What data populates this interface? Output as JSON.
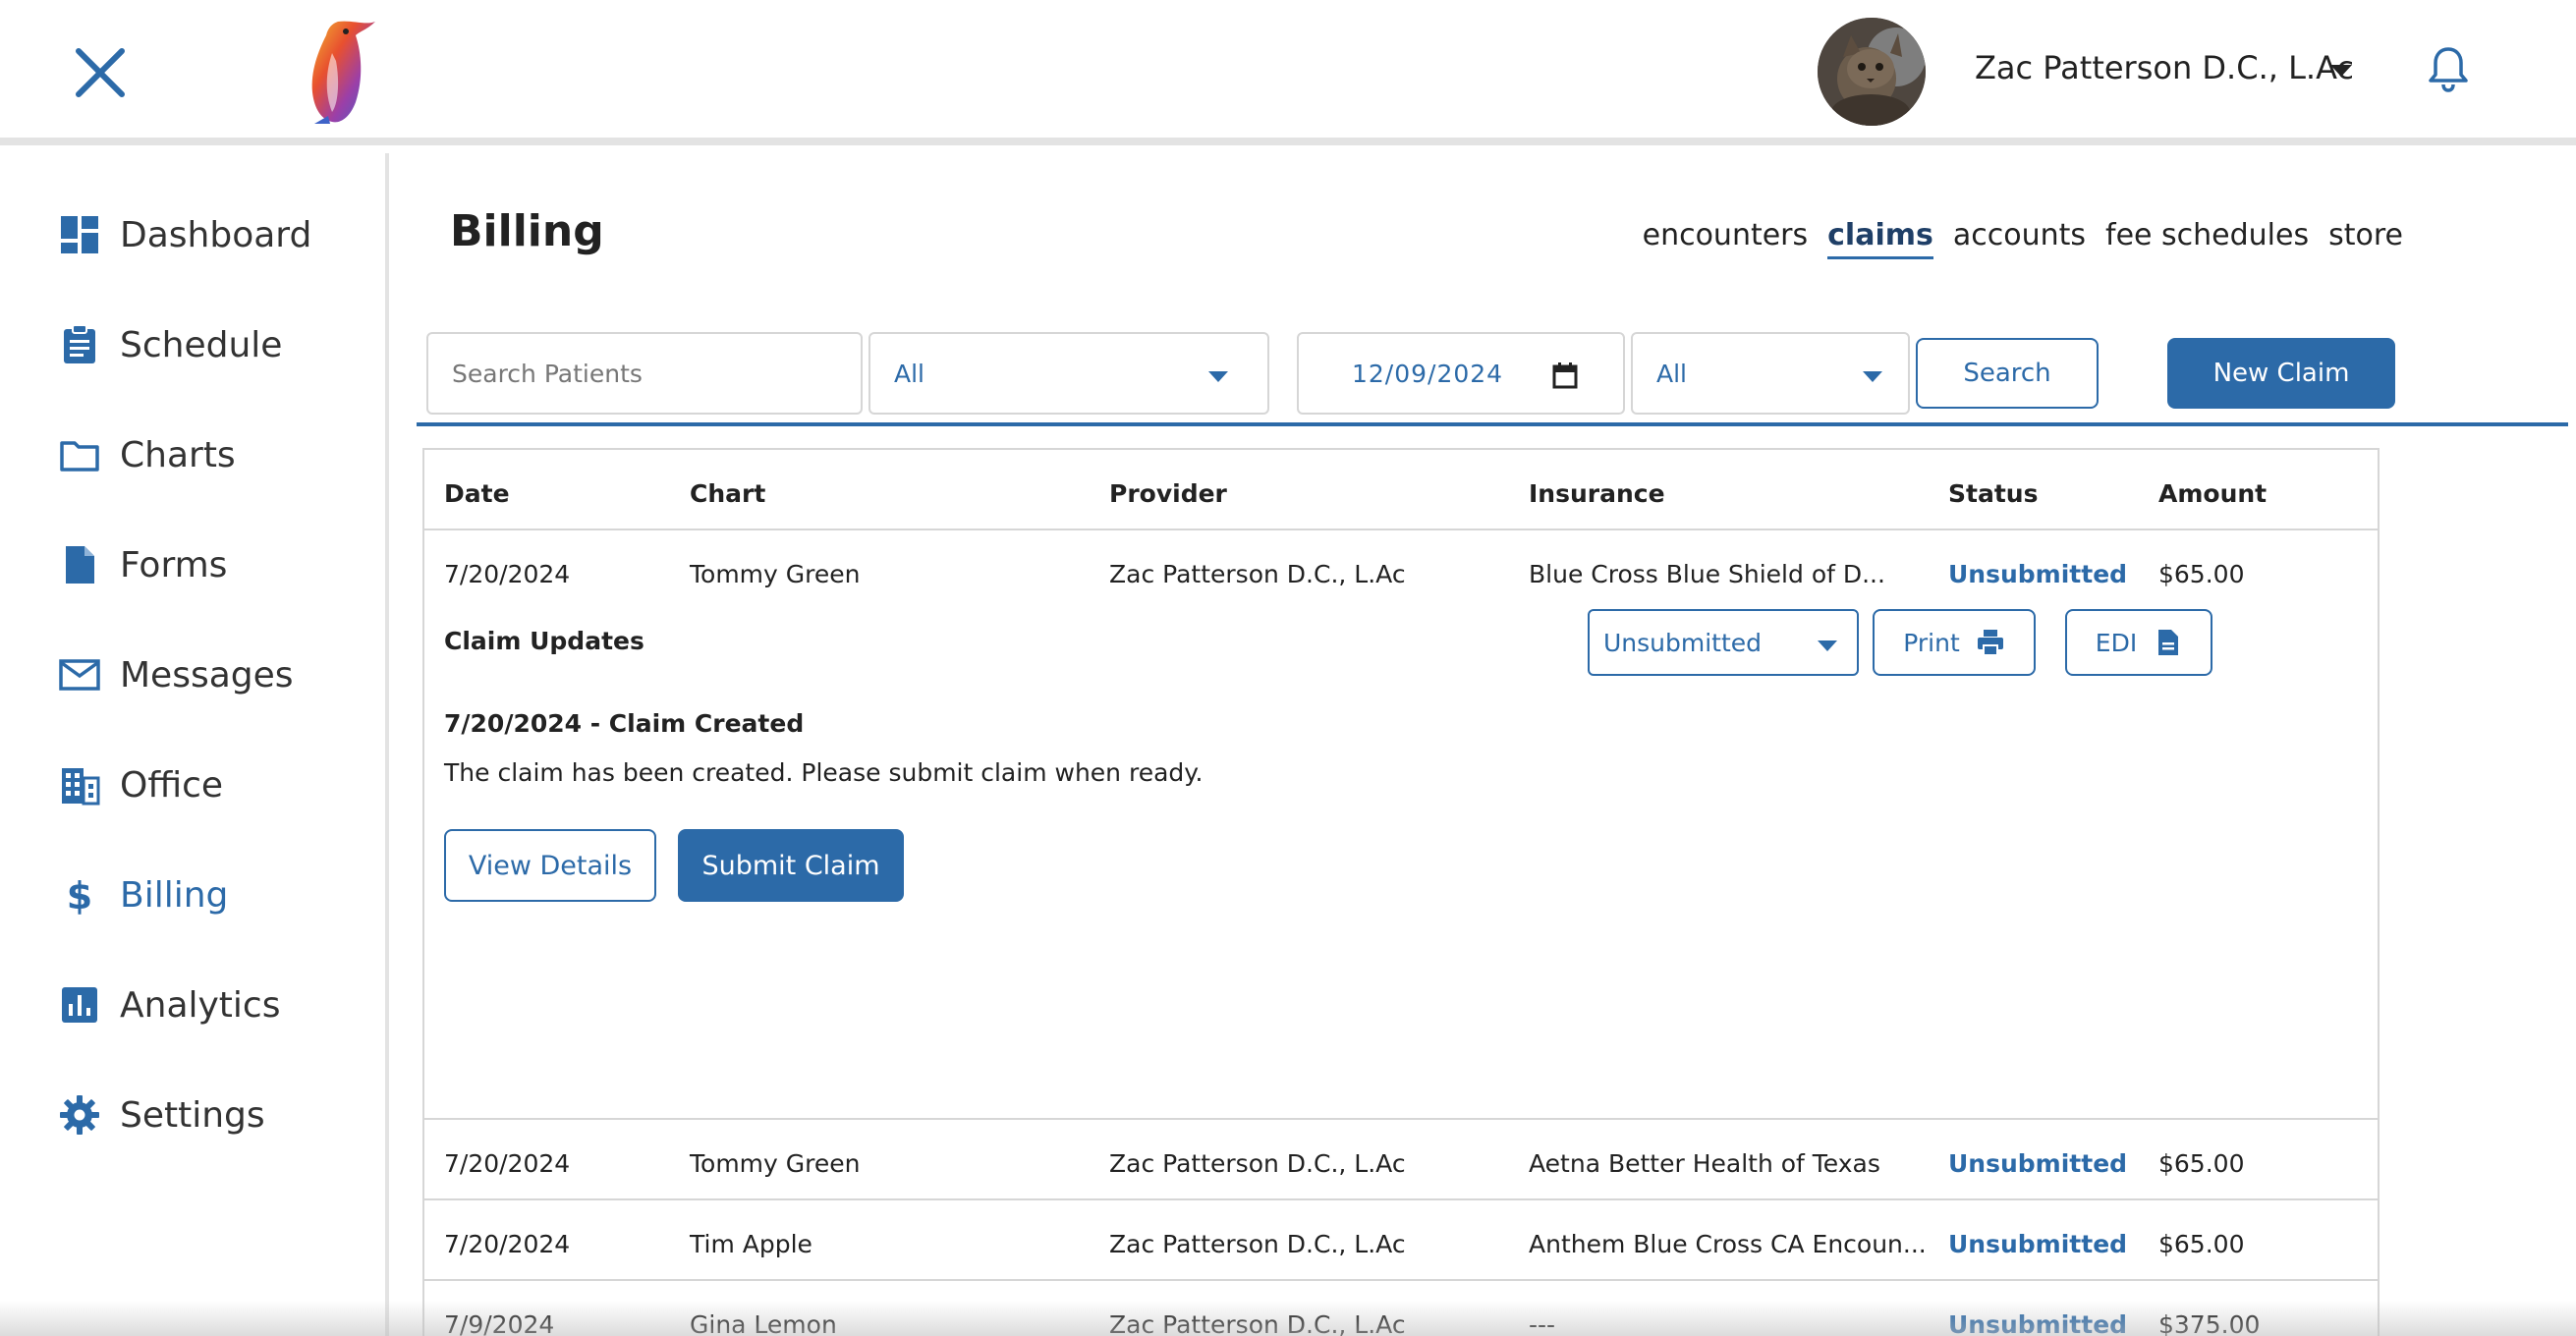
{
  "header": {
    "user_name": "Zac Patterson D.C., L.Ac"
  },
  "sidebar": {
    "items": [
      {
        "label": "Dashboard",
        "icon": "dashboard-icon"
      },
      {
        "label": "Schedule",
        "icon": "clipboard-icon"
      },
      {
        "label": "Charts",
        "icon": "folder-icon"
      },
      {
        "label": "Forms",
        "icon": "document-icon"
      },
      {
        "label": "Messages",
        "icon": "mail-icon"
      },
      {
        "label": "Office",
        "icon": "building-icon"
      },
      {
        "label": "Billing",
        "icon": "dollar-icon",
        "active": true
      },
      {
        "label": "Analytics",
        "icon": "bar-chart-icon"
      },
      {
        "label": "Settings",
        "icon": "gear-icon"
      }
    ]
  },
  "page": {
    "title": "Billing",
    "tabs": [
      {
        "label": "encounters"
      },
      {
        "label": "claims",
        "active": true
      },
      {
        "label": "accounts"
      },
      {
        "label": "fee schedules"
      },
      {
        "label": "store"
      }
    ]
  },
  "filters": {
    "search_placeholder": "Search Patients",
    "provider_select": "All",
    "date_value": "12/09/2024",
    "status_select": "All",
    "search_button": "Search",
    "new_claim_button": "New Claim"
  },
  "table": {
    "columns": [
      "Date",
      "Chart",
      "Provider",
      "Insurance",
      "Status",
      "Amount"
    ],
    "rows": [
      {
        "date": "7/20/2024",
        "chart": "Tommy Green",
        "provider": "Zac Patterson D.C., L.Ac",
        "insurance": "Blue Cross Blue Shield of D...",
        "status": "Unsubmitted",
        "amount": "$65.00"
      },
      {
        "date": "7/20/2024",
        "chart": "Tommy Green",
        "provider": "Zac Patterson D.C., L.Ac",
        "insurance": "Aetna Better Health of Texas",
        "status": "Unsubmitted",
        "amount": "$65.00"
      },
      {
        "date": "7/20/2024",
        "chart": "Tim Apple",
        "provider": "Zac Patterson D.C., L.Ac",
        "insurance": "Anthem Blue Cross CA Encoun...",
        "status": "Unsubmitted",
        "amount": "$65.00"
      },
      {
        "date": "7/9/2024",
        "chart": "Gina Lemon",
        "provider": "Zac Patterson D.C., L.Ac",
        "insurance": "---",
        "status": "Unsubmitted",
        "amount": "$375.00"
      }
    ]
  },
  "expanded": {
    "heading": "Claim Updates",
    "status_select": "Unsubmitted",
    "print_button": "Print",
    "edi_button": "EDI",
    "update_title": "7/20/2024 - Claim Created",
    "update_message": "The claim has been created. Please submit claim when ready.",
    "view_details_button": "View Details",
    "submit_claim_button": "Submit Claim"
  },
  "colors": {
    "accent": "#2c6aa8",
    "text": "#222222",
    "border": "#d6d6d6"
  }
}
